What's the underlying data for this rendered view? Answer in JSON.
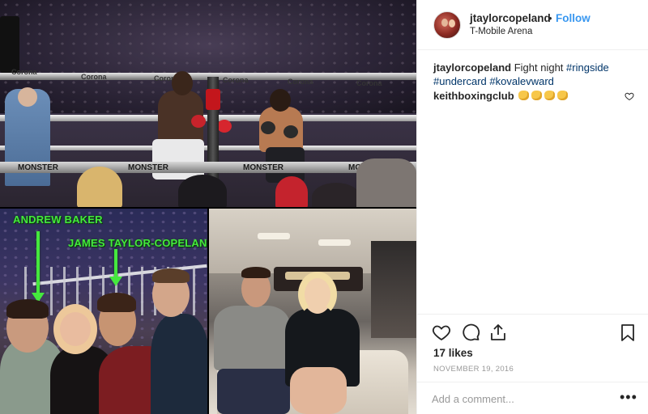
{
  "post": {
    "username": "jtaylorcopeland",
    "separator": "•",
    "follow_label": "Follow",
    "location": "T-Mobile Arena"
  },
  "caption": {
    "username": "jtaylorcopeland",
    "text": "Fight night",
    "hashtags": [
      "#ringside",
      "#undercard",
      "#kovalevward"
    ]
  },
  "comments": [
    {
      "username": "keithboxingclub",
      "emojis": [
        "fist-emoji",
        "fist-emoji",
        "thumbs-up-emoji",
        "thumbs-up-emoji"
      ]
    }
  ],
  "photo_labels": {
    "tag1": "ANDREW BAKER",
    "tag2": "JAMES TAYLOR-COPELAND"
  },
  "ring_banners": {
    "sponsor1": "Corona",
    "sponsor2": "MONSTER"
  },
  "engagement": {
    "likes": "17 likes",
    "date": "NOVEMBER 19, 2016"
  },
  "add_comment": {
    "placeholder": "Add a comment...",
    "more_label": "•••"
  },
  "icons": {
    "like": "heart-icon",
    "comment": "comment-icon",
    "share": "share-icon",
    "save": "bookmark-icon",
    "comment_like": "heart-icon"
  },
  "colors": {
    "follow": "#3897f0",
    "hashtag": "#003569",
    "tag_text": "#45e83e",
    "muted": "#999999"
  }
}
